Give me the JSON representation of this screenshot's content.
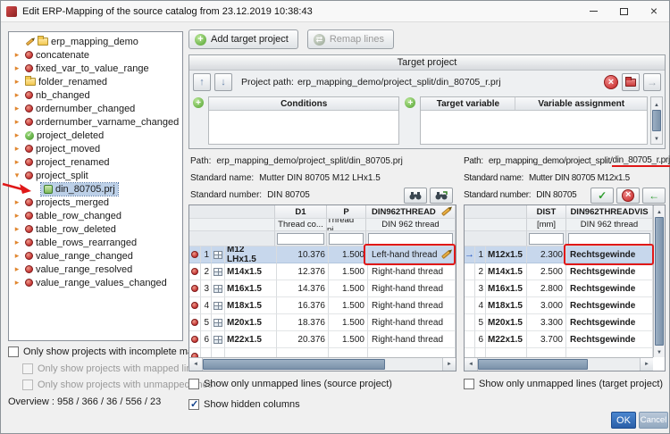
{
  "window": {
    "title": "Edit ERP-Mapping of the source catalog from 23.12.2019 10:38:43"
  },
  "toolbar": {
    "add_target_project": "Add target project",
    "remap_lines": "Remap lines"
  },
  "tree": {
    "items": [
      {
        "label": "erp_mapping_demo",
        "icon": "root",
        "expander": "none"
      },
      {
        "label": "concatenate",
        "icon": "gear",
        "expander": "collapsed"
      },
      {
        "label": "fixed_var_to_value_range",
        "icon": "gear",
        "expander": "collapsed"
      },
      {
        "label": "folder_renamed",
        "icon": "folder",
        "expander": "collapsed"
      },
      {
        "label": "nb_changed",
        "icon": "gear",
        "expander": "collapsed"
      },
      {
        "label": "ordernumber_changed",
        "icon": "gear",
        "expander": "collapsed"
      },
      {
        "label": "ordernumber_varname_changed",
        "icon": "gear",
        "expander": "collapsed"
      },
      {
        "label": "project_deleted",
        "icon": "check",
        "expander": "collapsed"
      },
      {
        "label": "project_moved",
        "icon": "gear",
        "expander": "collapsed"
      },
      {
        "label": "project_renamed",
        "icon": "gear",
        "expander": "collapsed"
      },
      {
        "label": "project_split",
        "icon": "gear",
        "expander": "expanded"
      },
      {
        "label": "din_80705.prj",
        "icon": "prj",
        "expander": "none",
        "child": true,
        "selected": true
      },
      {
        "label": "projects_merged",
        "icon": "gear",
        "expander": "collapsed"
      },
      {
        "label": "table_row_changed",
        "icon": "gear",
        "expander": "collapsed"
      },
      {
        "label": "table_row_deleted",
        "icon": "gear",
        "expander": "collapsed"
      },
      {
        "label": "table_rows_rearranged",
        "icon": "gear",
        "expander": "collapsed"
      },
      {
        "label": "value_range_changed",
        "icon": "gear",
        "expander": "collapsed"
      },
      {
        "label": "value_range_resolved",
        "icon": "gear",
        "expander": "collapsed"
      },
      {
        "label": "value_range_values_changed",
        "icon": "gear",
        "expander": "collapsed"
      }
    ]
  },
  "filters": {
    "incomplete": "Only show projects with incomplete mappings",
    "mapped": "Only show projects with mapped lines",
    "unmapped": "Only show projects with unmapped lines",
    "overview": "Overview : 958 / 366 / 36 / 556 / 23"
  },
  "target_project": {
    "header": "Target project",
    "project_path_label": "Project path:",
    "project_path": "erp_mapping_demo/project_split/din_80705_r.prj",
    "conditions_header": "Conditions",
    "target_variable_header": "Target variable",
    "variable_assignment_header": "Variable assignment"
  },
  "source_panel": {
    "path_label": "Path:",
    "path": "erp_mapping_demo/project_split/din_80705.prj",
    "standard_name_label": "Standard name:",
    "standard_name": "Mutter DIN 80705 M12 LHx1.5",
    "standard_number_label": "Standard number:",
    "standard_number": "DIN 80705"
  },
  "target_panel": {
    "path_label": "Path:",
    "path_prefix": "erp_mapping_demo/project_split/",
    "path_highlight": "din_80705_r.prj",
    "standard_name_label": "Standard name:",
    "standard_name": "Mutter DIN 80705 M12x1.5",
    "standard_number_label": "Standard number:",
    "standard_number": "DIN 80705"
  },
  "source_table": {
    "columns": [
      {
        "title": "D1",
        "subtitle": "Thread co..."
      },
      {
        "title": "P",
        "subtitle": "Thread pi..."
      },
      {
        "title": "DIN962THREAD",
        "subtitle": "DIN 962 thread",
        "editable": true
      }
    ],
    "rows": [
      {
        "num": "1",
        "name": "M12 LHx1.5",
        "d1": "10.376",
        "p": "1.500",
        "thread": "Left-hand thread",
        "selected": true,
        "editable_cell": true
      },
      {
        "num": "2",
        "name": "M14x1.5",
        "d1": "12.376",
        "p": "1.500",
        "thread": "Right-hand thread"
      },
      {
        "num": "3",
        "name": "M16x1.5",
        "d1": "14.376",
        "p": "1.500",
        "thread": "Right-hand thread"
      },
      {
        "num": "4",
        "name": "M18x1.5",
        "d1": "16.376",
        "p": "1.500",
        "thread": "Right-hand thread"
      },
      {
        "num": "5",
        "name": "M20x1.5",
        "d1": "18.376",
        "p": "1.500",
        "thread": "Right-hand thread"
      },
      {
        "num": "6",
        "name": "M22x1.5",
        "d1": "20.376",
        "p": "1.500",
        "thread": "Right-hand thread"
      }
    ]
  },
  "target_table": {
    "columns": [
      {
        "title": "DIST",
        "subtitle": "[mm]"
      },
      {
        "title": "DIN962THREADVIS",
        "subtitle": "DIN 962 thread"
      }
    ],
    "rows": [
      {
        "num": "1",
        "name": "M12x1.5",
        "dist": "2.300",
        "thread": "Rechtsgewinde",
        "selected": true
      },
      {
        "num": "2",
        "name": "M14x1.5",
        "dist": "2.500",
        "thread": "Rechtsgewinde"
      },
      {
        "num": "3",
        "name": "M16x1.5",
        "dist": "2.800",
        "thread": "Rechtsgewinde"
      },
      {
        "num": "4",
        "name": "M18x1.5",
        "dist": "3.000",
        "thread": "Rechtsgewinde"
      },
      {
        "num": "5",
        "name": "M20x1.5",
        "dist": "3.300",
        "thread": "Rechtsgewinde"
      },
      {
        "num": "6",
        "name": "M22x1.5",
        "dist": "3.700",
        "thread": "Rechtsgewinde"
      }
    ]
  },
  "table_filters": {
    "source_unmapped": "Show only unmapped lines (source project)",
    "target_unmapped": "Show only unmapped lines (target project)",
    "show_hidden": "Show hidden columns"
  },
  "footer": {
    "ok": "OK",
    "cancel": "Cancel"
  },
  "colors": {
    "annotation": "#e01818",
    "selection": "#c7d7ec",
    "accent_green": "#4a9e2f",
    "accent_red": "#c42222",
    "ok_blue": "#2e66b0"
  }
}
